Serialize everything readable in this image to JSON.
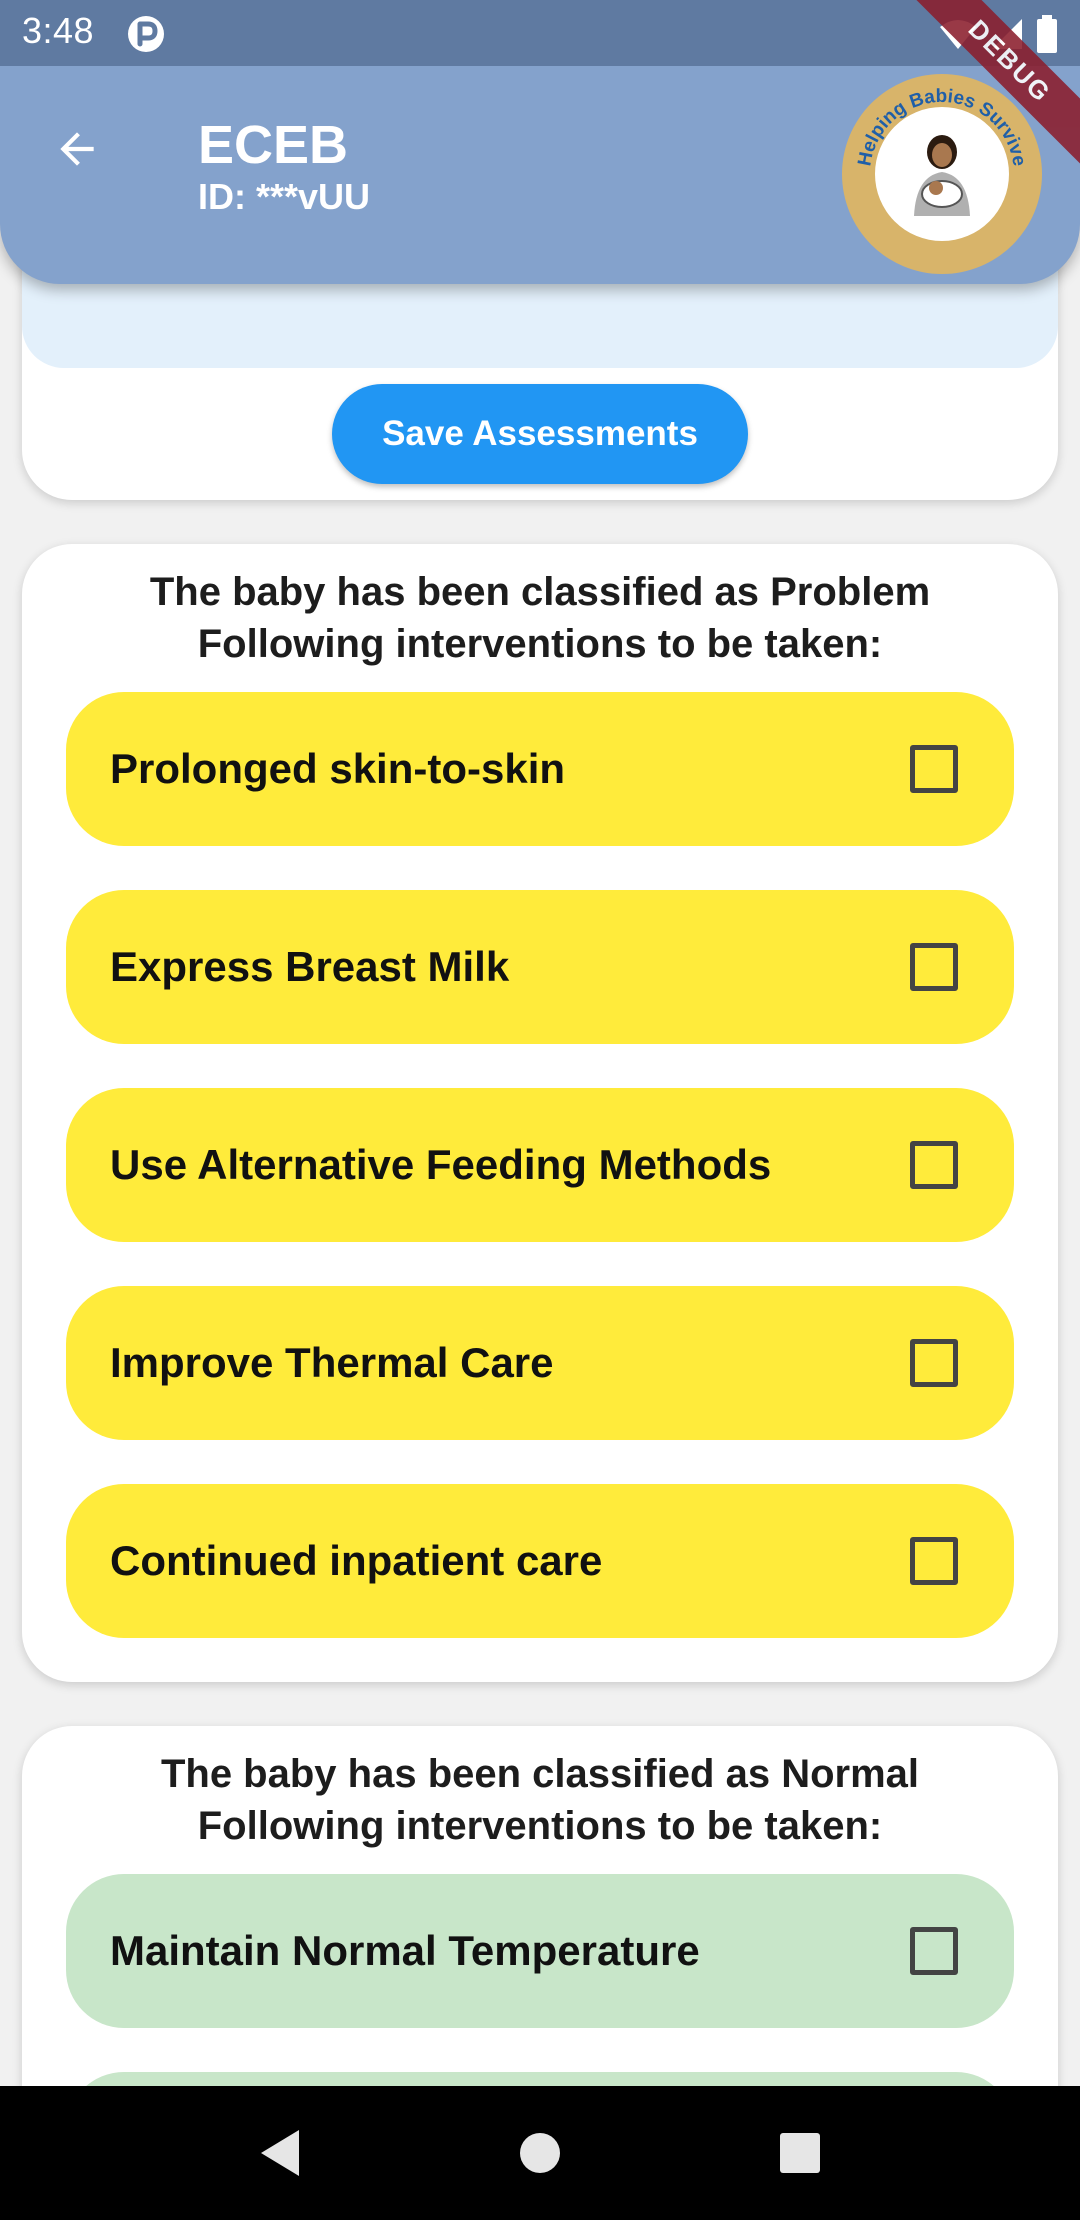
{
  "status_bar": {
    "time": "3:48"
  },
  "app_bar": {
    "title": "ECEB",
    "subtitle": "ID: ***vUU",
    "logo_text": "Helping Babies Survive"
  },
  "debug_banner": "DEBUG",
  "assessment_card": {
    "save_label": "Save Assessments"
  },
  "problem_card": {
    "heading_line1": "The baby has been classified as Problem",
    "heading_line2": "Following interventions to be taken:",
    "items": [
      {
        "label": "Prolonged skin-to-skin",
        "checked": false
      },
      {
        "label": "Express Breast Milk",
        "checked": false
      },
      {
        "label": "Use Alternative Feeding Methods",
        "checked": false
      },
      {
        "label": "Improve Thermal Care",
        "checked": false
      },
      {
        "label": "Continued inpatient care",
        "checked": false
      }
    ]
  },
  "normal_card": {
    "heading_line1": "The baby has been classified as Normal",
    "heading_line2": "Following interventions to be taken:",
    "items": [
      {
        "label": "Maintain Normal Temperature",
        "checked": false
      }
    ]
  },
  "colors": {
    "status_bar": "#5f7aa1",
    "app_bar": "#84a2cc",
    "primary_button": "#2196f3",
    "problem_item": "#ffeb3b",
    "normal_item": "#c8e6c9",
    "debug_ribbon": "#8b1e2d"
  },
  "icons": {
    "back": "arrow-left-icon",
    "wifi": "wifi-icon",
    "signal": "signal-icon",
    "battery": "battery-icon",
    "nav_back": "triangle-back-icon",
    "nav_home": "circle-home-icon",
    "nav_recents": "square-recents-icon"
  }
}
